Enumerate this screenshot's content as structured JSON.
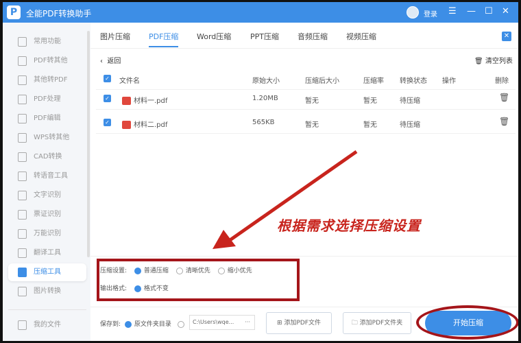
{
  "app": {
    "title": "全能PDF转换助手",
    "login": "登录",
    "logo": "P"
  },
  "sidebar": {
    "items": [
      {
        "label": "常用功能"
      },
      {
        "label": "PDF转其他"
      },
      {
        "label": "其他转PDF"
      },
      {
        "label": "PDF处理"
      },
      {
        "label": "PDF编辑"
      },
      {
        "label": "WPS转其他"
      },
      {
        "label": "CAD转换"
      },
      {
        "label": "转语音工具"
      },
      {
        "label": "文字识别"
      },
      {
        "label": "票证识别"
      },
      {
        "label": "万能识别"
      },
      {
        "label": "翻译工具"
      },
      {
        "label": "压缩工具",
        "active": true
      },
      {
        "label": "图片转换"
      }
    ],
    "my_files": "我的文件"
  },
  "tabs": [
    {
      "label": "图片压缩"
    },
    {
      "label": "PDF压缩",
      "active": true
    },
    {
      "label": "Word压缩"
    },
    {
      "label": "PPT压缩"
    },
    {
      "label": "音频压缩"
    },
    {
      "label": "视频压缩"
    }
  ],
  "toolbar": {
    "back": "返回",
    "clear": "清空列表"
  },
  "table": {
    "headers": [
      "文件名",
      "原始大小",
      "压缩后大小",
      "压缩率",
      "转换状态",
      "操作",
      "删除"
    ],
    "rows": [
      {
        "name": "材料一.pdf",
        "size": "1.20MB",
        "after": "暂无",
        "rate": "暂无",
        "status": "待压缩"
      },
      {
        "name": "材料二.pdf",
        "size": "565KB",
        "after": "暂无",
        "rate": "暂无",
        "status": "待压缩"
      }
    ]
  },
  "annotation": "根据需求选择压缩设置",
  "settings": {
    "compress_label": "压缩设置:",
    "options": [
      "普通压缩",
      "清晰优先",
      "缩小优先"
    ],
    "selected": "普通压缩",
    "format_label": "输出格式:",
    "format_option": "格式不变"
  },
  "bottom": {
    "save_label": "保存到:",
    "source_dir": "原文件夹目录",
    "path": "C:\\Users\\wqe...",
    "more": "···",
    "add_file": "添加PDF文件",
    "add_folder": "添加PDF文件夹",
    "start": "开始压缩"
  },
  "colors": {
    "accent": "#3d8ee6",
    "annotation": "#a4151a"
  }
}
